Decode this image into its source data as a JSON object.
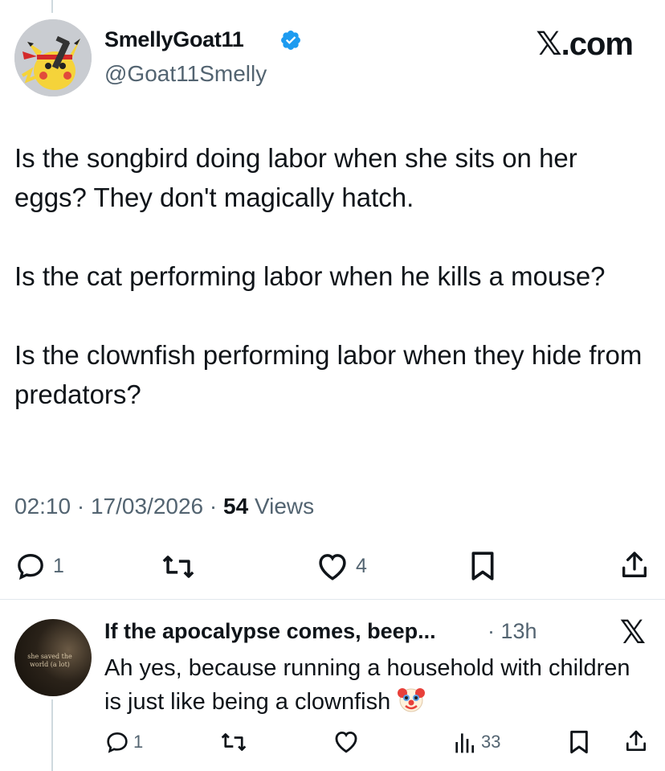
{
  "tweet": {
    "display_name": "SmellyGoat11",
    "handle": "@Goat11Smelly",
    "brand": "𝕏.com",
    "paragraphs": [
      "Is the songbird doing labor when she sits on her eggs? They don't magically hatch.",
      "Is the cat performing labor when he kills a mouse?",
      "Is the clownfish performing labor when they hide from predators?"
    ],
    "time": "02:10",
    "separator": "·",
    "date": "17/03/2026",
    "views_count": "54",
    "views_label": "Views",
    "actions": {
      "replies": "1",
      "likes": "4"
    },
    "colors": {
      "verified": "#1d9bf0",
      "muted": "#536471",
      "text": "#0f1419"
    }
  },
  "reply": {
    "display_name": "If the apocalypse comes, beep...",
    "time": "· 13h",
    "x_icon_label": "𝕏",
    "avatar_caption": "she saved the world (a lot)",
    "text": "Ah yes, because running a household with children is just like being a clownfish",
    "emoji": "clown-face",
    "actions": {
      "replies": "1",
      "views": "33"
    }
  }
}
